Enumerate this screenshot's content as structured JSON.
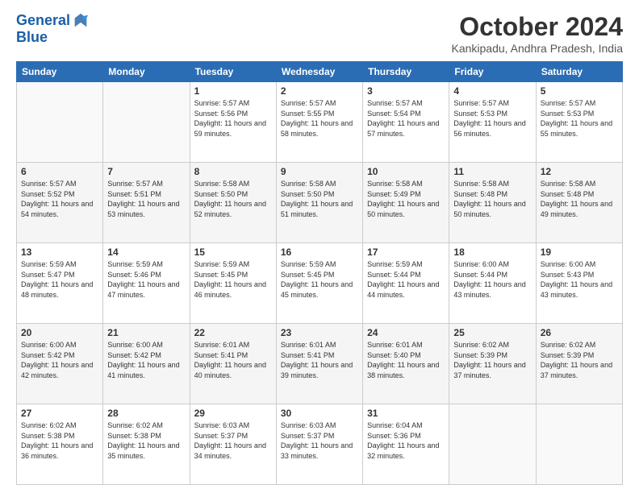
{
  "logo": {
    "line1": "General",
    "line2": "Blue"
  },
  "title": "October 2024",
  "location": "Kankipadu, Andhra Pradesh, India",
  "weekdays": [
    "Sunday",
    "Monday",
    "Tuesday",
    "Wednesday",
    "Thursday",
    "Friday",
    "Saturday"
  ],
  "weeks": [
    [
      {
        "day": "",
        "info": ""
      },
      {
        "day": "",
        "info": ""
      },
      {
        "day": "1",
        "info": "Sunrise: 5:57 AM\nSunset: 5:56 PM\nDaylight: 11 hours and 59 minutes."
      },
      {
        "day": "2",
        "info": "Sunrise: 5:57 AM\nSunset: 5:55 PM\nDaylight: 11 hours and 58 minutes."
      },
      {
        "day": "3",
        "info": "Sunrise: 5:57 AM\nSunset: 5:54 PM\nDaylight: 11 hours and 57 minutes."
      },
      {
        "day": "4",
        "info": "Sunrise: 5:57 AM\nSunset: 5:53 PM\nDaylight: 11 hours and 56 minutes."
      },
      {
        "day": "5",
        "info": "Sunrise: 5:57 AM\nSunset: 5:53 PM\nDaylight: 11 hours and 55 minutes."
      }
    ],
    [
      {
        "day": "6",
        "info": "Sunrise: 5:57 AM\nSunset: 5:52 PM\nDaylight: 11 hours and 54 minutes."
      },
      {
        "day": "7",
        "info": "Sunrise: 5:57 AM\nSunset: 5:51 PM\nDaylight: 11 hours and 53 minutes."
      },
      {
        "day": "8",
        "info": "Sunrise: 5:58 AM\nSunset: 5:50 PM\nDaylight: 11 hours and 52 minutes."
      },
      {
        "day": "9",
        "info": "Sunrise: 5:58 AM\nSunset: 5:50 PM\nDaylight: 11 hours and 51 minutes."
      },
      {
        "day": "10",
        "info": "Sunrise: 5:58 AM\nSunset: 5:49 PM\nDaylight: 11 hours and 50 minutes."
      },
      {
        "day": "11",
        "info": "Sunrise: 5:58 AM\nSunset: 5:48 PM\nDaylight: 11 hours and 50 minutes."
      },
      {
        "day": "12",
        "info": "Sunrise: 5:58 AM\nSunset: 5:48 PM\nDaylight: 11 hours and 49 minutes."
      }
    ],
    [
      {
        "day": "13",
        "info": "Sunrise: 5:59 AM\nSunset: 5:47 PM\nDaylight: 11 hours and 48 minutes."
      },
      {
        "day": "14",
        "info": "Sunrise: 5:59 AM\nSunset: 5:46 PM\nDaylight: 11 hours and 47 minutes."
      },
      {
        "day": "15",
        "info": "Sunrise: 5:59 AM\nSunset: 5:45 PM\nDaylight: 11 hours and 46 minutes."
      },
      {
        "day": "16",
        "info": "Sunrise: 5:59 AM\nSunset: 5:45 PM\nDaylight: 11 hours and 45 minutes."
      },
      {
        "day": "17",
        "info": "Sunrise: 5:59 AM\nSunset: 5:44 PM\nDaylight: 11 hours and 44 minutes."
      },
      {
        "day": "18",
        "info": "Sunrise: 6:00 AM\nSunset: 5:44 PM\nDaylight: 11 hours and 43 minutes."
      },
      {
        "day": "19",
        "info": "Sunrise: 6:00 AM\nSunset: 5:43 PM\nDaylight: 11 hours and 43 minutes."
      }
    ],
    [
      {
        "day": "20",
        "info": "Sunrise: 6:00 AM\nSunset: 5:42 PM\nDaylight: 11 hours and 42 minutes."
      },
      {
        "day": "21",
        "info": "Sunrise: 6:00 AM\nSunset: 5:42 PM\nDaylight: 11 hours and 41 minutes."
      },
      {
        "day": "22",
        "info": "Sunrise: 6:01 AM\nSunset: 5:41 PM\nDaylight: 11 hours and 40 minutes."
      },
      {
        "day": "23",
        "info": "Sunrise: 6:01 AM\nSunset: 5:41 PM\nDaylight: 11 hours and 39 minutes."
      },
      {
        "day": "24",
        "info": "Sunrise: 6:01 AM\nSunset: 5:40 PM\nDaylight: 11 hours and 38 minutes."
      },
      {
        "day": "25",
        "info": "Sunrise: 6:02 AM\nSunset: 5:39 PM\nDaylight: 11 hours and 37 minutes."
      },
      {
        "day": "26",
        "info": "Sunrise: 6:02 AM\nSunset: 5:39 PM\nDaylight: 11 hours and 37 minutes."
      }
    ],
    [
      {
        "day": "27",
        "info": "Sunrise: 6:02 AM\nSunset: 5:38 PM\nDaylight: 11 hours and 36 minutes."
      },
      {
        "day": "28",
        "info": "Sunrise: 6:02 AM\nSunset: 5:38 PM\nDaylight: 11 hours and 35 minutes."
      },
      {
        "day": "29",
        "info": "Sunrise: 6:03 AM\nSunset: 5:37 PM\nDaylight: 11 hours and 34 minutes."
      },
      {
        "day": "30",
        "info": "Sunrise: 6:03 AM\nSunset: 5:37 PM\nDaylight: 11 hours and 33 minutes."
      },
      {
        "day": "31",
        "info": "Sunrise: 6:04 AM\nSunset: 5:36 PM\nDaylight: 11 hours and 32 minutes."
      },
      {
        "day": "",
        "info": ""
      },
      {
        "day": "",
        "info": ""
      }
    ]
  ]
}
